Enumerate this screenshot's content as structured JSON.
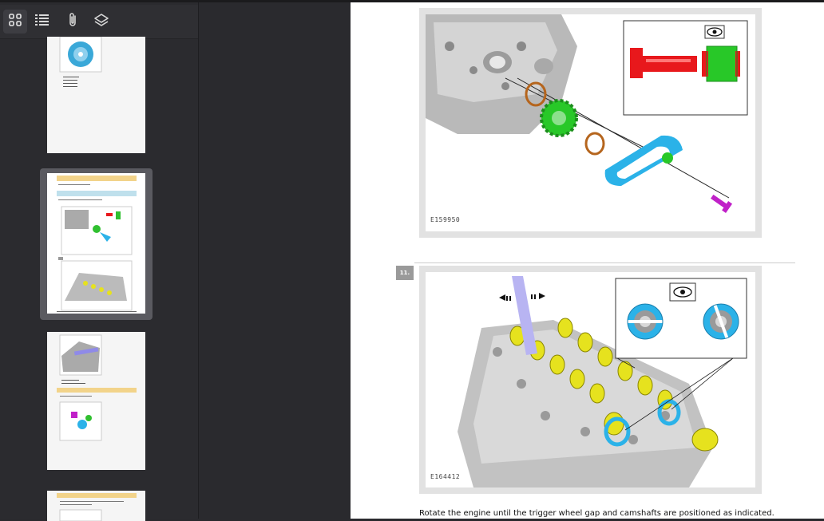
{
  "toolbar": {
    "buttons": [
      {
        "name": "thumbnails-view",
        "icon": "grid-icon",
        "active": true
      },
      {
        "name": "outline-view",
        "icon": "list-icon",
        "active": false
      },
      {
        "name": "attachments-view",
        "icon": "paperclip-icon",
        "active": false
      },
      {
        "name": "layers-view",
        "icon": "layers-icon",
        "active": false
      }
    ]
  },
  "thumbnails": [
    {
      "page": "page-1",
      "selected": false
    },
    {
      "page": "page-2",
      "selected": true
    },
    {
      "page": "page-3",
      "selected": false
    },
    {
      "page": "page-4",
      "selected": false
    }
  ],
  "document": {
    "figure1_label": "E159950",
    "step_number": "11.",
    "figure2_label": "E164412",
    "caption": "Rotate the engine until the trigger wheel gap and camshafts are positioned as indicated."
  },
  "colors": {
    "accent_cyan": "#2bb2e8",
    "accent_green": "#28c828",
    "accent_yellow": "#e6e21e",
    "accent_red": "#e8181c",
    "accent_magenta": "#c021c8",
    "accent_orange": "#b5651d",
    "tool_lavender": "#b8b4f2"
  }
}
